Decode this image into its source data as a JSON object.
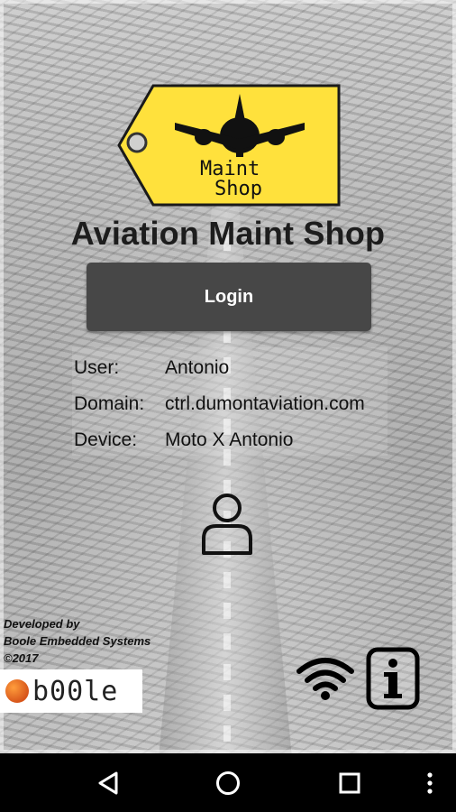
{
  "app": {
    "title": "Aviation Maint Shop",
    "logo_text": [
      "Maint",
      "Shop"
    ]
  },
  "login": {
    "label": "Login"
  },
  "info": {
    "rows": [
      {
        "label": "User:",
        "value": "Antonio"
      },
      {
        "label": "Domain:",
        "value": "ctrl.dumontaviation.com"
      },
      {
        "label": "Device:",
        "value": "Moto X Antonio"
      }
    ]
  },
  "footer": {
    "credit_lines": [
      "Developed by",
      "Boole Embedded Systems",
      "©2017"
    ],
    "brand_logo_text": "b00le"
  },
  "icons": {
    "user": "user-icon",
    "wifi": "wifi-icon",
    "info": "info-icon",
    "nav_back": "back-triangle-icon",
    "nav_home": "home-circle-icon",
    "nav_recent": "recent-square-icon",
    "nav_menu": "overflow-menu-icon"
  },
  "colors": {
    "tag_yellow": "#FFE13C",
    "button_bg": "#474747",
    "boole_orange": "#E3621F"
  }
}
